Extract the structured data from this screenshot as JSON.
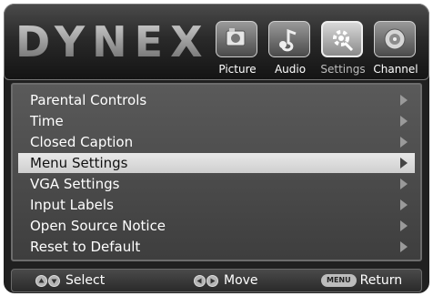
{
  "brand": {
    "logo_text": "DYNEX"
  },
  "tabs": [
    {
      "label": "Picture",
      "icon": "picture-icon",
      "active": false
    },
    {
      "label": "Audio",
      "icon": "audio-icon",
      "active": false
    },
    {
      "label": "Settings",
      "icon": "settings-icon",
      "active": true
    },
    {
      "label": "Channel",
      "icon": "channel-icon",
      "active": false
    }
  ],
  "menu": {
    "items": [
      {
        "label": "Parental Controls"
      },
      {
        "label": "Time"
      },
      {
        "label": "Closed Caption"
      },
      {
        "label": "Menu Settings",
        "selected": true
      },
      {
        "label": "VGA Settings"
      },
      {
        "label": "Input Labels"
      },
      {
        "label": "Open Source Notice"
      },
      {
        "label": "Reset to Default"
      }
    ]
  },
  "footer": {
    "select_label": "Select",
    "move_label": "Move",
    "menu_key": "MENU",
    "return_label": "Return"
  },
  "colors": {
    "selected_highlight": "#dcdcdc",
    "menu_background": "#4a4a4a",
    "frame": "#202020"
  }
}
